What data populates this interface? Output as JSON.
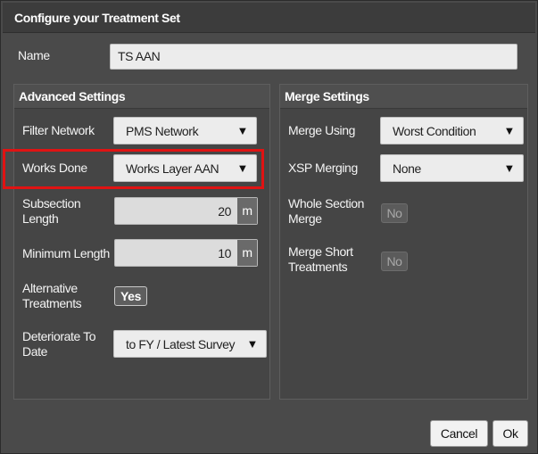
{
  "dialog": {
    "title": "Configure your Treatment Set",
    "name_label": "Name",
    "name_value": "TS AAN"
  },
  "advanced": {
    "title": "Advanced Settings",
    "filter_network_label": "Filter Network",
    "filter_network_value": "PMS Network",
    "works_done_label": "Works Done",
    "works_done_value": "Works Layer AAN",
    "subsection_length_label": "Subsection Length",
    "subsection_length_value": "20",
    "subsection_length_unit": "m",
    "minimum_length_label": "Minimum Length",
    "minimum_length_value": "10",
    "minimum_length_unit": "m",
    "alternative_treatments_label": "Alternative Treatments",
    "alternative_treatments_value": "Yes",
    "deteriorate_to_date_label": "Deteriorate To Date",
    "deteriorate_to_date_value": "to FY / Latest Survey"
  },
  "merge": {
    "title": "Merge Settings",
    "merge_using_label": "Merge Using",
    "merge_using_value": "Worst Condition",
    "xsp_merging_label": "XSP Merging",
    "xsp_merging_value": "None",
    "whole_section_merge_label": "Whole Section Merge",
    "whole_section_merge_value": "No",
    "merge_short_treatments_label": "Merge Short Treatments",
    "merge_short_treatments_value": "No"
  },
  "footer": {
    "cancel_label": "Cancel",
    "ok_label": "Ok"
  },
  "icons": {
    "dropdown_arrow": "▼",
    "dropdown_arrow_name": "chevron-down-icon"
  },
  "colors": {
    "highlight_border": "#e01313",
    "dialog_background": "#4a4a4a",
    "field_background": "#ececec"
  }
}
